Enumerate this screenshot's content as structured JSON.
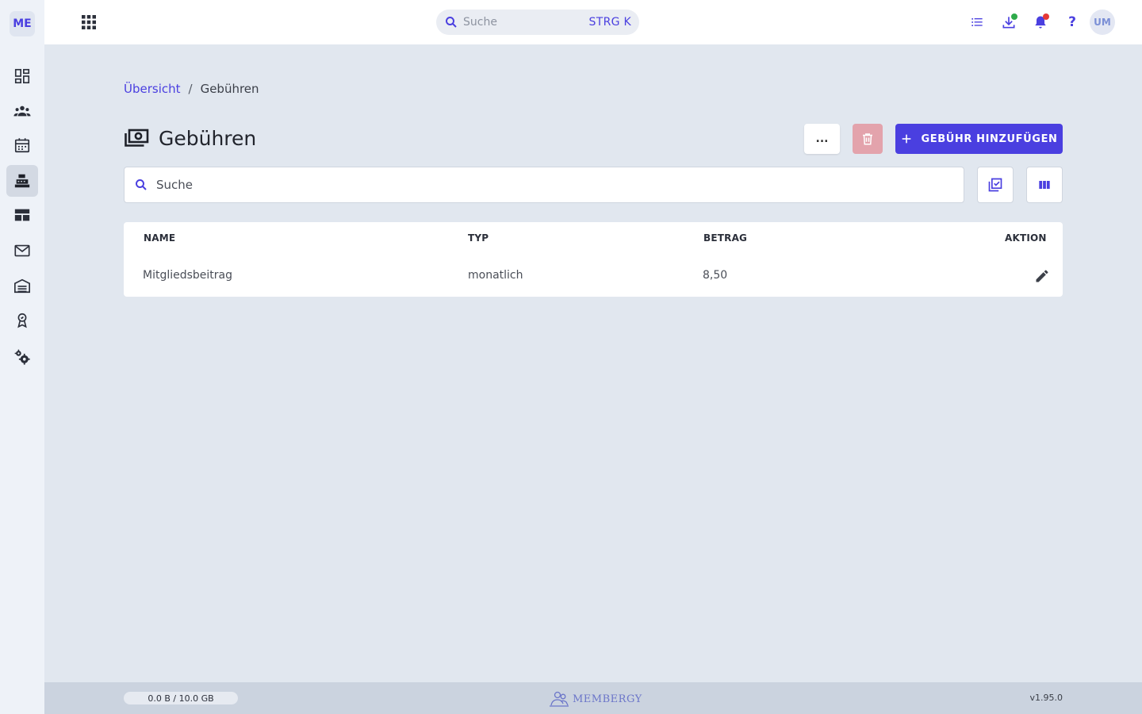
{
  "app": {
    "logo_text": "ME",
    "brand_name": "MEMBERGY",
    "version": "v1.95.0"
  },
  "colors": {
    "accent": "#4a3fe0",
    "delete_disabled": "#e3a3ac",
    "status_green": "#2eaa4a",
    "status_red": "#e53935"
  },
  "sidebar": {
    "items": [
      {
        "icon": "dashboard-icon",
        "active": false
      },
      {
        "icon": "members-icon",
        "active": false
      },
      {
        "icon": "calendar-icon",
        "active": false
      },
      {
        "icon": "cash-register-icon",
        "active": true
      },
      {
        "icon": "layout-icon",
        "active": false
      },
      {
        "icon": "mail-icon",
        "active": false
      },
      {
        "icon": "warehouse-icon",
        "active": false
      },
      {
        "icon": "award-icon",
        "active": false
      },
      {
        "icon": "settings-icon",
        "active": false
      }
    ]
  },
  "topbar": {
    "search_placeholder": "Suche",
    "search_shortcut": "STRG K",
    "help_label": "?",
    "avatar_initials": "UM"
  },
  "breadcrumb": {
    "parent": "Übersicht",
    "separator": "/",
    "current": "Gebühren"
  },
  "page": {
    "title": "Gebühren",
    "more_label": "...",
    "add_label": "GEBÜHR HINZUFÜGEN",
    "search_placeholder": "Suche"
  },
  "table": {
    "columns": [
      "NAME",
      "TYP",
      "BETRAG",
      "AKTION"
    ],
    "rows": [
      {
        "name": "Mitgliedsbeitrag",
        "type": "monatlich",
        "amount": "8,50"
      }
    ]
  },
  "footer": {
    "storage": "0.0 B / 10.0 GB"
  }
}
